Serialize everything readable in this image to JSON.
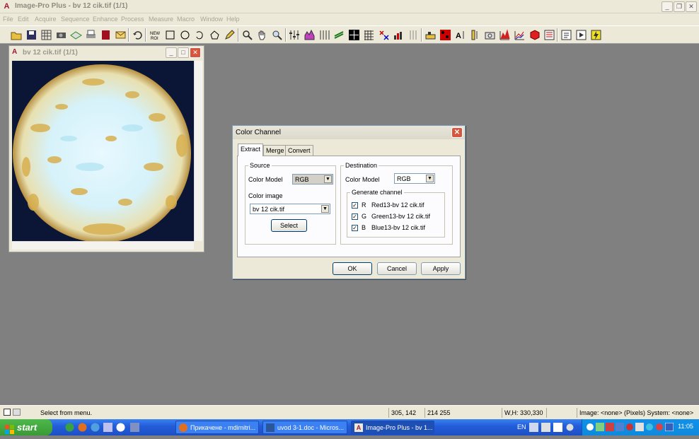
{
  "app": {
    "title": "Image-Pro Plus - bv 12 cik.tif (1/1)",
    "menu": [
      "File",
      "Edit",
      "Acquire",
      "Sequence",
      "Enhance",
      "Process",
      "Measure",
      "Macro",
      "Window",
      "Help"
    ]
  },
  "image_window": {
    "title": "bv 12 cik.tif (1/1)"
  },
  "dialog": {
    "title": "Color Channel",
    "tabs": [
      "Extract",
      "Merge",
      "Convert"
    ],
    "source": {
      "group_label": "Source",
      "color_model_label": "Color Model",
      "color_model_value": "RGB",
      "color_image_label": "Color image",
      "color_image_value": "bv 12 cik.tif",
      "select_button": "Select"
    },
    "destination": {
      "group_label": "Destination",
      "color_model_label": "Color Model",
      "color_model_value": "RGB",
      "generate_label": "Generate channel",
      "channels": [
        {
          "letter": "R",
          "name": "Red13-bv 12 cik.tif",
          "checked": true
        },
        {
          "letter": "G",
          "name": "Green13-bv 12 cik.tif",
          "checked": true
        },
        {
          "letter": "B",
          "name": "Blue13-bv 12 cik.tif",
          "checked": true
        }
      ]
    },
    "buttons": {
      "ok": "OK",
      "cancel": "Cancel",
      "apply": "Apply"
    }
  },
  "status": {
    "message": "Select from menu.",
    "coords": "305, 142",
    "rgb": "214 255",
    "wh": "W,H: 330,330",
    "system": "Image: <none> (Pixels) System: <none>"
  },
  "taskbar": {
    "start": "start",
    "tasks": [
      "Прикачене - mdimitri...",
      "uvod 3-1.doc - Micros...",
      "Image-Pro Plus - bv 1..."
    ],
    "lang": "EN",
    "clock": "11:05"
  }
}
